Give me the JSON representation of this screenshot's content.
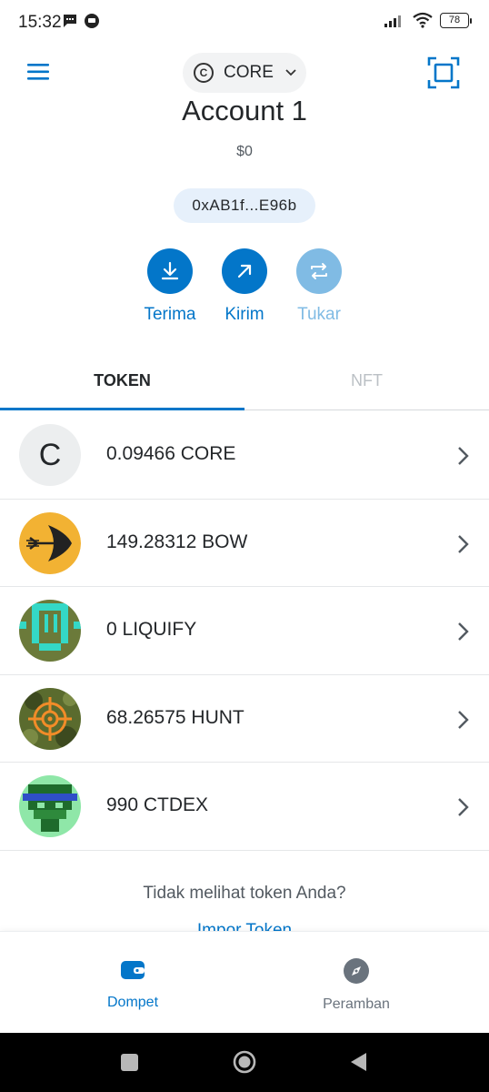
{
  "status_bar": {
    "time": "15:32",
    "battery": "78"
  },
  "header": {
    "network_name": "CORE",
    "network_logo_letter": "C"
  },
  "account": {
    "name": "Account 1",
    "balance": "$0",
    "address": "0xAB1f...E96b"
  },
  "actions": [
    {
      "label": "Terima",
      "icon": "download-icon"
    },
    {
      "label": "Kirim",
      "icon": "send-arrow-icon"
    },
    {
      "label": "Tukar",
      "icon": "swap-icon",
      "disabled": true
    }
  ],
  "tabs": [
    {
      "label": "TOKEN",
      "active": true
    },
    {
      "label": "NFT",
      "active": false
    }
  ],
  "tokens": [
    {
      "amount": "0.09466 CORE",
      "icon": "core-token-icon"
    },
    {
      "amount": "149.28312 BOW",
      "icon": "bow-token-icon"
    },
    {
      "amount": "0 LIQUIFY",
      "icon": "liquify-token-icon"
    },
    {
      "amount": "68.26575 HUNT",
      "icon": "hunt-token-icon"
    },
    {
      "amount": "990 CTDEX",
      "icon": "ctdex-token-icon"
    }
  ],
  "footer": {
    "no_token_text": "Tidak melihat token Anda?",
    "import_link": "Impor Token"
  },
  "bottom_nav": [
    {
      "label": "Dompet",
      "active": true,
      "icon": "wallet-icon"
    },
    {
      "label": "Peramban",
      "active": false,
      "icon": "compass-icon"
    }
  ],
  "colors": {
    "accent": "#0376c9",
    "accent_disabled": "#80bbe4",
    "text": "#24272a",
    "muted": "#535a61"
  }
}
